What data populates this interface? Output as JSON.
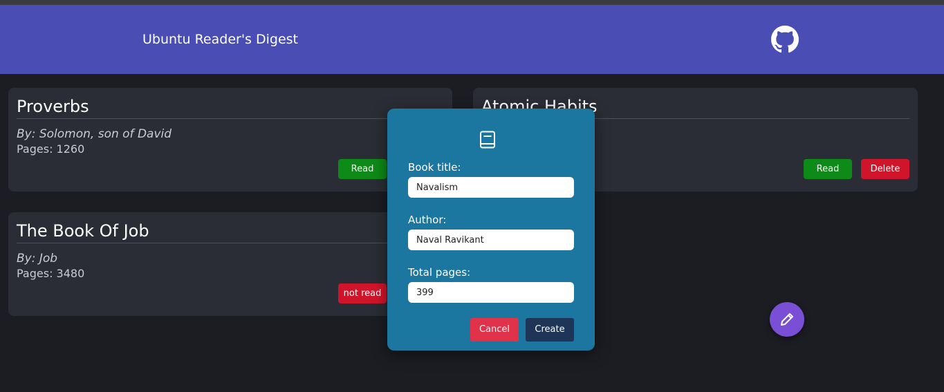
{
  "header": {
    "brand": "Ubuntu Reader's Digest",
    "github_icon": "github-icon"
  },
  "books": [
    {
      "title": "Proverbs",
      "author": "By: Solomon, son of David",
      "pages": "Pages: 1260",
      "status_label": "Read"
    },
    {
      "title": "Atomic Habits",
      "status_label": "Read",
      "delete_label": "Delete"
    },
    {
      "title": "The Book Of Job",
      "author": "By: Job",
      "pages": "Pages: 3480",
      "status_label": "not read"
    }
  ],
  "modal": {
    "icon": "book-icon",
    "title_label": "Book title:",
    "title_value": "Navalism",
    "author_label": "Author:",
    "author_value": "Naval Ravikant",
    "pages_label": "Total pages:",
    "pages_value": "399",
    "cancel_label": "Cancel",
    "create_label": "Create"
  },
  "fab": {
    "icon": "pencil-icon"
  },
  "colors": {
    "header": "#4a4eb4",
    "modal": "#1c77a0",
    "read": "#0d8a17",
    "not_read": "#d0152b",
    "create": "#1e3558",
    "cancel": "#e0334a",
    "fab": "#7a4fd6"
  }
}
